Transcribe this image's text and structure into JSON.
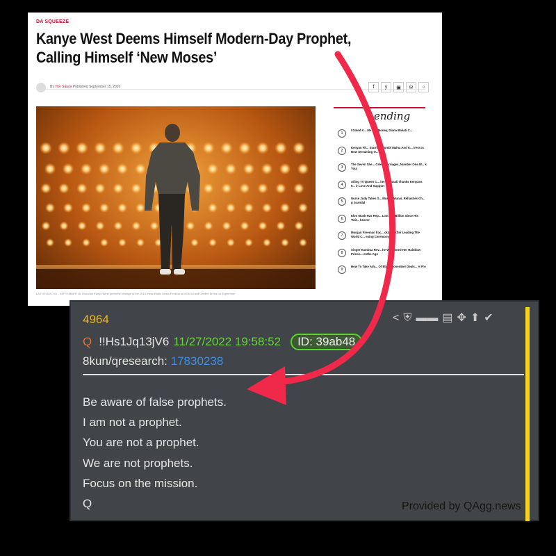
{
  "article": {
    "section": "DA SQUEEZE",
    "headline": "Kanye West Deems Himself Modern-Day Prophet, Calling Himself ‘New Moses’",
    "byline_prefix": "By",
    "author": "The Sauce",
    "published": "Published September 15, 2020",
    "photo_caption": "LAS VEGAS, NV - SEPTEMBER 18: Musician Kanye West performs onstage at the 2015 iHeartRadio Music Festival at MGM Grand Garden Arena on September",
    "trending_title": "ending",
    "trending": [
      {
        "num": "1",
        "text": "I Dated K... Me For Money, Diana Bahati C..."
      },
      {
        "num": "2",
        "text": "Kenyan Fil... Starring Mumbi Maina And K... tress Is Now Streaming O..."
      },
      {
        "num": "3",
        "text": "The Seven She... Celeb Marriages, Number One W... k You!"
      },
      {
        "num": "4",
        "text": "Ailing TV Queen C... ine Kasanali Thanks Kenyans F... ir Love And Support"
      },
      {
        "num": "5",
        "text": "Nurse Judy Takes S... Murugi Munyi, Rehashes Ch... g Scandal"
      },
      {
        "num": "6",
        "text": "Elon Musk Has Rep... Lost $92 Billion Since His Twit... keover"
      },
      {
        "num": "7",
        "text": "Morgan Freeman Fac... cklash After Leading The World C... ening Ceremony"
      },
      {
        "num": "8",
        "text": "Singer Kambua Rev... he Welcomed Her Rainbow Prince... onths Ago"
      },
      {
        "num": "9",
        "text": "How To Take Adv... Of Black November Deals... A Pro"
      }
    ],
    "social_icons": [
      "f",
      "y",
      "▣",
      "✉",
      "○"
    ]
  },
  "qpost": {
    "post_number": "4964",
    "q_label": "Q",
    "tripcode": "!!Hs1Jq13jV6",
    "datetime": "11/27/2022 19:58:52",
    "id_badge": "ID: 39ab48",
    "board": "8kun/qresearch:",
    "thread": "17830238",
    "message_lines": [
      "Be aware of false prophets.",
      "I am not a prophet.",
      "You are not a prophet.",
      "We are not prophets.",
      "Focus on the mission.",
      "Q"
    ],
    "credit": "Provided by QAgg.news",
    "icons": [
      "share-icon",
      "shield-icon",
      "glasses-icon",
      "document-icon",
      "move-icon",
      "arrow-up-icon",
      "check-icon"
    ]
  },
  "colors": {
    "accent_red": "#c8102e",
    "arrow_red": "#f0284a",
    "post_number_gold": "#f0b21b",
    "date_green": "#62d838",
    "link_blue": "#3c8ee6",
    "side_bar_yellow": "#f7d21a"
  }
}
